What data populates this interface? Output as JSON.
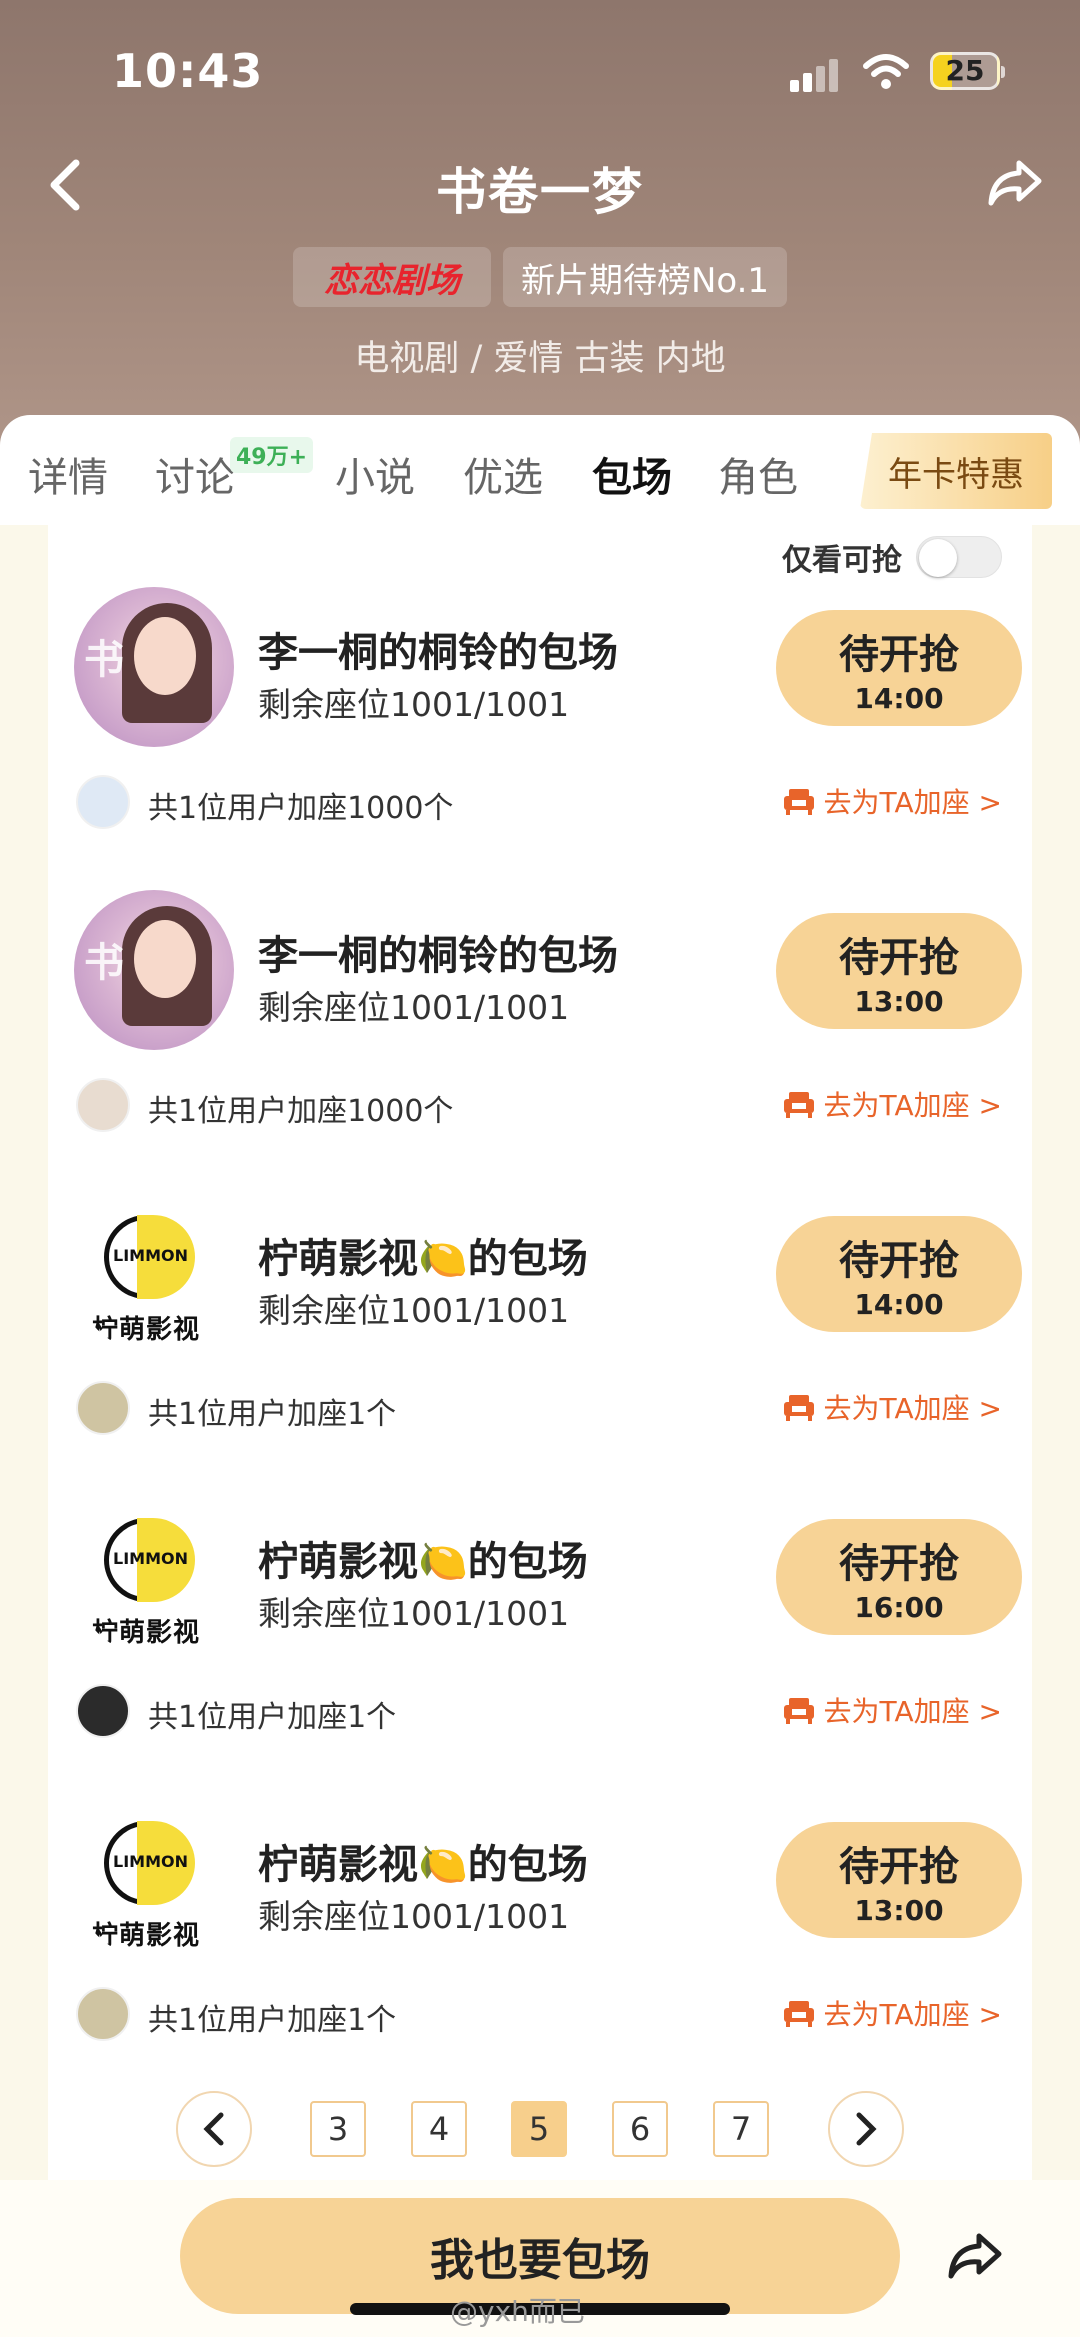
{
  "status_bar": {
    "time": "10:43",
    "battery": "25"
  },
  "header": {
    "title": "书卷一梦",
    "brand_tag": "恋恋剧场",
    "rank_tag": "新片期待榜No.1",
    "genre": "电视剧 / 爱情 古装 内地"
  },
  "tabs": {
    "items": [
      "详情",
      "讨论",
      "小说",
      "优选",
      "包场",
      "角色"
    ],
    "active": "包场",
    "discussion_badge": "49万+",
    "annual_card": "年卡特惠"
  },
  "filter": {
    "label": "仅看可抢",
    "enabled": false
  },
  "cards": [
    {
      "title": "李一桐的桐铃的包场",
      "seats": "剩余座位1001/1001",
      "button": "待开抢",
      "time": "14:00",
      "users": "共1位用户加座1000个",
      "join": "去为TA加座 >",
      "avatar": "photo"
    },
    {
      "title": "李一桐的桐铃的包场",
      "seats": "剩余座位1001/1001",
      "button": "待开抢",
      "time": "13:00",
      "users": "共1位用户加座1000个",
      "join": "去为TA加座 >",
      "avatar": "photo"
    },
    {
      "title": "柠萌影视🍋的包场",
      "seats": "剩余座位1001/1001",
      "button": "待开抢",
      "time": "14:00",
      "users": "共1位用户加座1个",
      "join": "去为TA加座 >",
      "avatar": "lemon"
    },
    {
      "title": "柠萌影视🍋的包场",
      "seats": "剩余座位1001/1001",
      "button": "待开抢",
      "time": "16:00",
      "users": "共1位用户加座1个",
      "join": "去为TA加座 >",
      "avatar": "lemon"
    },
    {
      "title": "柠萌影视🍋的包场",
      "seats": "剩余座位1001/1001",
      "button": "待开抢",
      "time": "13:00",
      "users": "共1位用户加座1个",
      "join": "去为TA加座 >",
      "avatar": "lemon"
    }
  ],
  "lemon_logo": {
    "mark": "LIMMON",
    "name": "柠萌影视"
  },
  "pagination": {
    "pages": [
      "3",
      "4",
      "5",
      "6",
      "7"
    ],
    "current": "5"
  },
  "bottom": {
    "cta": "我也要包场"
  },
  "watermark": "@yxh而已",
  "colors": {
    "accent": "#f7d396",
    "link": "#e8642a",
    "badge": "#3db057",
    "brand": "#e8242d"
  }
}
